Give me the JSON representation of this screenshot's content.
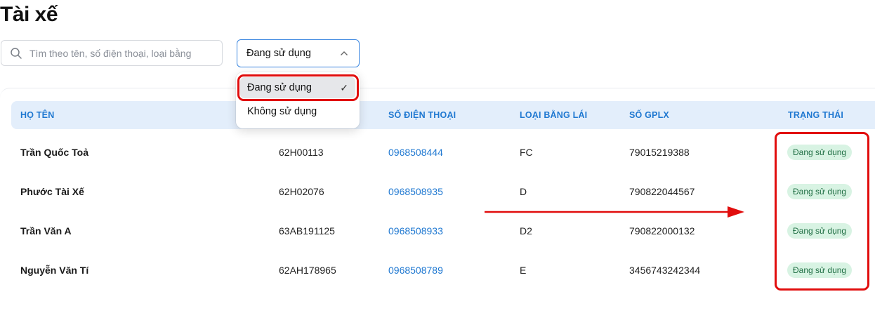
{
  "page": {
    "title": "Tài xế"
  },
  "search": {
    "placeholder": "Tìm theo tên, số điện thoại, loại bằng"
  },
  "status_filter": {
    "value": "Đang sử dụng",
    "options": [
      {
        "label": "Đang sử dụng",
        "selected": true
      },
      {
        "label": "Không sử dụng",
        "selected": false
      }
    ]
  },
  "table": {
    "headers": {
      "name": "HỌ TÊN",
      "phone": "SỐ ĐIỆN THOẠI",
      "license_type": "LOẠI BẰNG LÁI",
      "license_no": "SỐ GPLX",
      "status": "TRẠNG THÁI"
    },
    "rows": [
      {
        "name": "Trần Quốc Toả",
        "plate": "62H00113",
        "phone": "0968508444",
        "license_type": "FC",
        "license_no": "79015219388",
        "status": "Đang sử dụng"
      },
      {
        "name": "Phước Tài Xế",
        "plate": "62H02076",
        "phone": "0968508935",
        "license_type": "D",
        "license_no": "790822044567",
        "status": "Đang sử dụng"
      },
      {
        "name": "Trần Văn A",
        "plate": "63AB191125",
        "phone": "0968508933",
        "license_type": "D2",
        "license_no": "790822000132",
        "status": "Đang sử dụng"
      },
      {
        "name": "Nguyễn Văn Tí",
        "plate": "62AH178965",
        "phone": "0968508789",
        "license_type": "E",
        "license_no": "3456743242344",
        "status": "Đang sử dụng"
      }
    ]
  },
  "colors": {
    "accent": "#1f78d1",
    "header_bg": "#e3eefb",
    "badge_bg": "#d8f3e3",
    "badge_text": "#1f6e43",
    "annotation": "#e10d0d"
  },
  "icons": {
    "search": "search-icon",
    "select_caret": "chevron-up-icon",
    "selected_mark": "check-icon"
  }
}
